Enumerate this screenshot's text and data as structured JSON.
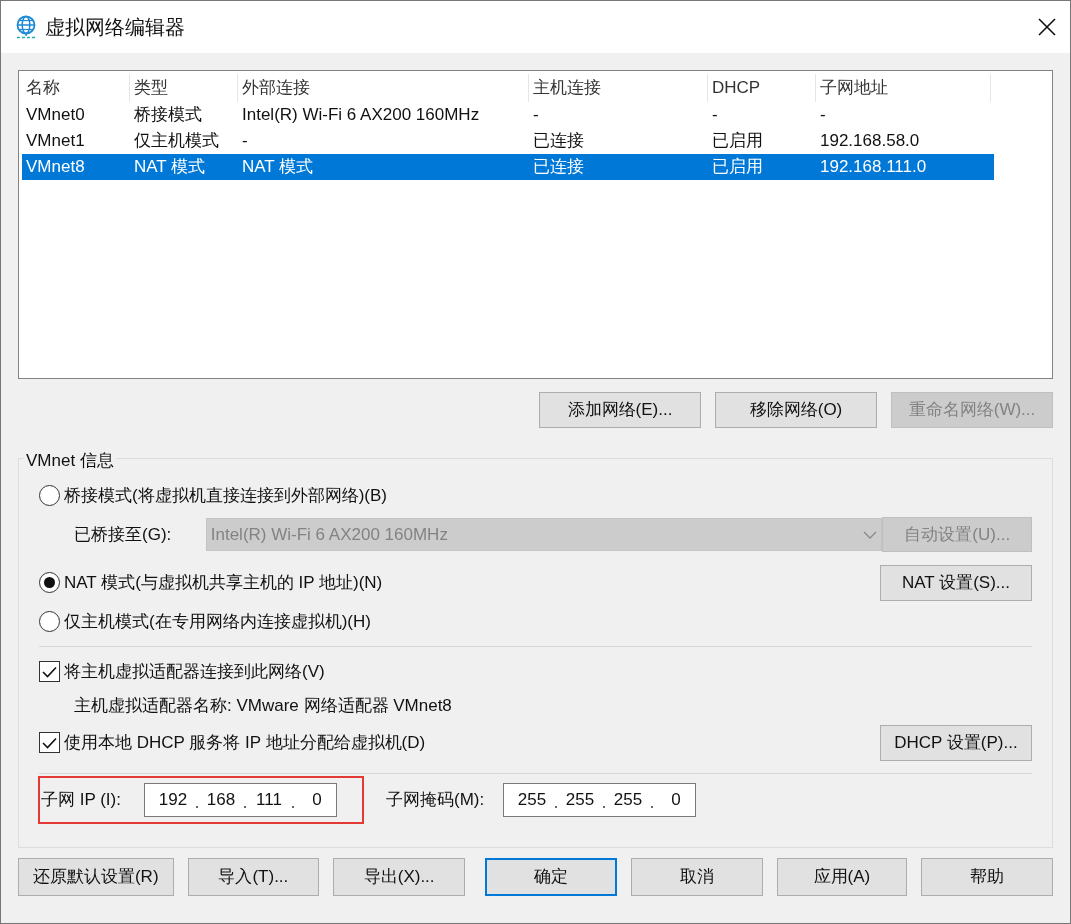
{
  "window": {
    "title": "虚拟网络编辑器"
  },
  "network_table": {
    "columns": [
      "名称",
      "类型",
      "外部连接",
      "主机连接",
      "DHCP",
      "子网地址"
    ],
    "rows": [
      {
        "cells": [
          "VMnet0",
          "桥接模式",
          "Intel(R) Wi-Fi 6 AX200 160MHz",
          "-",
          "-",
          "-"
        ],
        "selected": false
      },
      {
        "cells": [
          "VMnet1",
          "仅主机模式",
          "-",
          "已连接",
          "已启用",
          "192.168.58.0"
        ],
        "selected": false
      },
      {
        "cells": [
          "VMnet8",
          "NAT 模式",
          "NAT 模式",
          "已连接",
          "已启用",
          "192.168.111.0"
        ],
        "selected": true
      }
    ]
  },
  "table_buttons": [
    {
      "label": "添加网络(E)...",
      "disabled": false
    },
    {
      "label": "移除网络(O)",
      "disabled": false
    },
    {
      "label": "重命名网络(W)...",
      "disabled": true
    }
  ],
  "vmnet_info": {
    "title": "VMnet 信息",
    "bridged_mode": {
      "label": "桥接模式(将虚拟机直接连接到外部网络)(B)",
      "selected": false
    },
    "bridged_to": {
      "label": "已桥接至(G):",
      "value": "Intel(R) Wi-Fi 6 AX200 160MHz",
      "disabled": true
    },
    "auto_settings_button": {
      "label": "自动设置(U)...",
      "disabled": true
    },
    "nat_mode": {
      "label": "NAT 模式(与虚拟机共享主机的 IP 地址)(N)",
      "selected": true
    },
    "nat_settings_button": {
      "label": "NAT 设置(S)...",
      "disabled": false
    },
    "host_only_mode": {
      "label": "仅主机模式(在专用网络内连接虚拟机)(H)",
      "selected": false
    },
    "connect_adapter": {
      "label": "将主机虚拟适配器连接到此网络(V)",
      "checked": true
    },
    "adapter_name": "主机虚拟适配器名称: VMware 网络适配器 VMnet8",
    "use_dhcp": {
      "label": "使用本地 DHCP 服务将 IP 地址分配给虚拟机(D)",
      "checked": true
    },
    "dhcp_settings_button": {
      "label": "DHCP 设置(P)...",
      "disabled": false
    },
    "subnet_ip": {
      "label": "子网 IP (I):",
      "octets": [
        "192",
        "168",
        "111",
        "0"
      ]
    },
    "subnet_mask": {
      "label": "子网掩码(M):",
      "octets": [
        "255",
        "255",
        "255",
        "0"
      ]
    }
  },
  "footer_buttons": [
    {
      "label": "还原默认设置(R)",
      "default": false
    },
    {
      "label": "导入(T)...",
      "default": false
    },
    {
      "label": "导出(X)...",
      "default": false
    },
    {
      "label": "确定",
      "default": true
    },
    {
      "label": "取消",
      "default": false
    },
    {
      "label": "应用(A)",
      "default": false
    },
    {
      "label": "帮助",
      "default": false
    }
  ]
}
